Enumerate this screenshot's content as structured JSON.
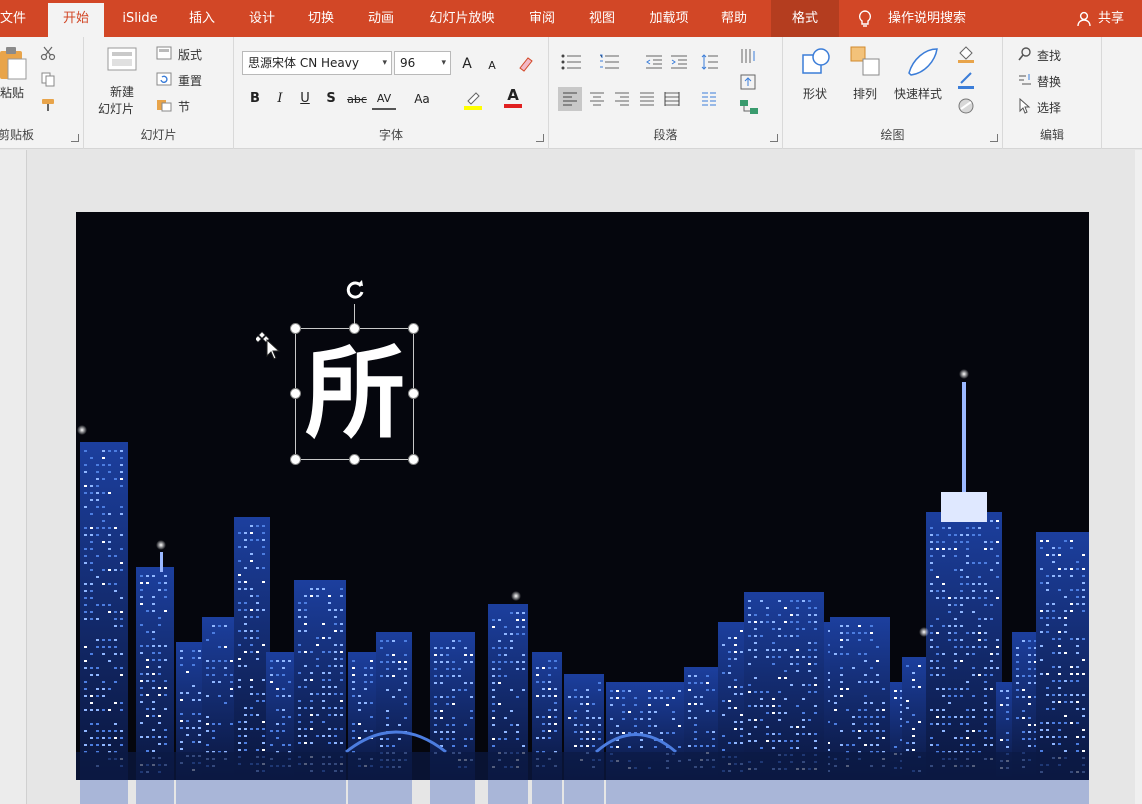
{
  "tabs": [
    "文件",
    "开始",
    "iSlide",
    "插入",
    "设计",
    "切换",
    "动画",
    "幻灯片放映",
    "审阅",
    "视图",
    "加载项",
    "帮助",
    "格式"
  ],
  "tell_me": "操作说明搜索",
  "share": "共享",
  "ribbon": {
    "clipboard": {
      "paste": "粘贴",
      "label": "剪贴板"
    },
    "slides": {
      "new_slide_1": "新建",
      "new_slide_2": "幻灯片",
      "layout": "版式",
      "reset": "重置",
      "section": "节",
      "label": "幻灯片"
    },
    "font": {
      "font_name": "思源宋体 CN Heavy",
      "font_size": "96",
      "grow": "A",
      "shrink": "A",
      "bold": "B",
      "italic": "I",
      "underline": "U",
      "shadow": "S",
      "strike": "abc",
      "spacing": "AV",
      "case": "Aa",
      "font_color": "A",
      "label": "字体"
    },
    "paragraph": {
      "label": "段落"
    },
    "drawing": {
      "shapes": "形状",
      "arrange": "排列",
      "quick_styles": "快速样式",
      "label": "绘图"
    },
    "editing": {
      "find": "查找",
      "replace": "替换",
      "select": "选择",
      "label": "编辑"
    }
  },
  "slide": {
    "text": "所",
    "background": "#05060d"
  },
  "colors": {
    "accent": "#d24726",
    "ribbon_bg": "#f3f3f3",
    "highlight": "#ffff00",
    "font_red": "#e02020"
  }
}
